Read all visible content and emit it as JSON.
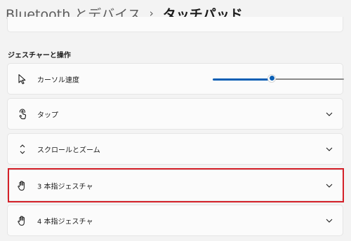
{
  "breadcrumb": {
    "parent": "Bluetooth とデバイス",
    "separator": "›",
    "current": "タッチパッド"
  },
  "section": {
    "header": "ジェスチャーと操作"
  },
  "rows": [
    {
      "label": "カーソル速度",
      "icon": "cursor-icon",
      "control": "slider",
      "slider_value_fraction": 0.45
    },
    {
      "label": "タップ",
      "icon": "tap-icon",
      "control": "expander"
    },
    {
      "label": "スクロールとズーム",
      "icon": "scroll-zoom-icon",
      "control": "expander"
    },
    {
      "label": "3 本指ジェスチャ",
      "icon": "hand-icon",
      "control": "expander",
      "highlighted": true
    },
    {
      "label": "4 本指ジェスチャ",
      "icon": "hand-icon",
      "control": "expander"
    }
  ],
  "colors": {
    "accent": "#0a5fb4",
    "highlight_border": "#d42028",
    "background": "#f3f3f3",
    "card": "#fbfbfb"
  }
}
